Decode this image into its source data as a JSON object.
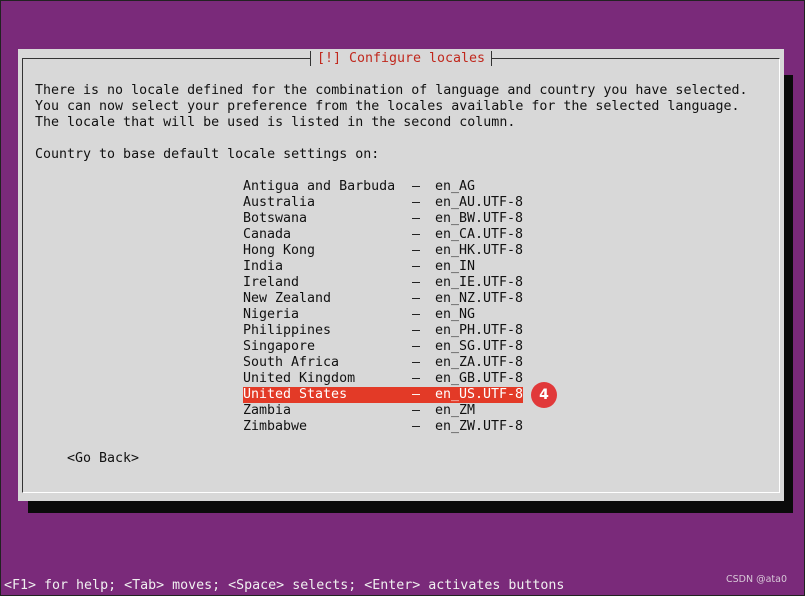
{
  "dialog": {
    "title": "[!] Configure locales",
    "message_lines": [
      "There is no locale defined for the combination of language and country you have selected.",
      "You can now select your preference from the locales available for the selected language.",
      "The locale that will be used is listed in the second column."
    ],
    "prompt": "Country to base default locale settings on:",
    "items": [
      {
        "country": "Antigua and Barbuda",
        "locale": "en_AG"
      },
      {
        "country": "Australia",
        "locale": "en_AU.UTF-8"
      },
      {
        "country": "Botswana",
        "locale": "en_BW.UTF-8"
      },
      {
        "country": "Canada",
        "locale": "en_CA.UTF-8"
      },
      {
        "country": "Hong Kong",
        "locale": "en_HK.UTF-8"
      },
      {
        "country": "India",
        "locale": "en_IN"
      },
      {
        "country": "Ireland",
        "locale": "en_IE.UTF-8"
      },
      {
        "country": "New Zealand",
        "locale": "en_NZ.UTF-8"
      },
      {
        "country": "Nigeria",
        "locale": "en_NG"
      },
      {
        "country": "Philippines",
        "locale": "en_PH.UTF-8"
      },
      {
        "country": "Singapore",
        "locale": "en_SG.UTF-8"
      },
      {
        "country": "South Africa",
        "locale": "en_ZA.UTF-8"
      },
      {
        "country": "United Kingdom",
        "locale": "en_GB.UTF-8"
      },
      {
        "country": "United States",
        "locale": "en_US.UTF-8",
        "selected": true
      },
      {
        "country": "Zambia",
        "locale": "en_ZM"
      },
      {
        "country": "Zimbabwe",
        "locale": "en_ZW.UTF-8"
      }
    ],
    "separator": "–",
    "go_back_label": "<Go Back>"
  },
  "step_marker": "4",
  "footer": "<F1> for help; <Tab> moves; <Space> selects; <Enter> activates buttons",
  "watermark": "CSDN @ata0",
  "colors": {
    "background": "#7a2a7a",
    "dialog": "#d8d8d8",
    "selection": "#e33a27",
    "title_text": "#c0281d"
  }
}
